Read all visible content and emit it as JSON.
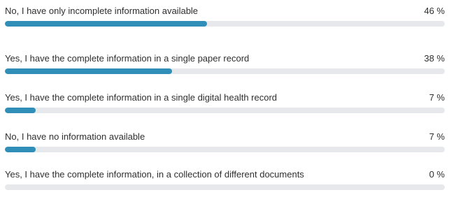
{
  "chart_data": {
    "type": "bar",
    "orientation": "horizontal",
    "categories": [
      "No, I have only incomplete information available",
      "Yes, I have the complete information in a single paper record",
      "Yes, I have the complete information in a single digital health record",
      "No, I have no information available",
      "Yes, I have the complete information, in a collection of different documents"
    ],
    "values": [
      46,
      38,
      7,
      7,
      0
    ],
    "value_labels": [
      "46 %",
      "38 %",
      "7 %",
      "7 %",
      "0 %"
    ],
    "xlim": [
      0,
      100
    ],
    "bar_color": "#2f8fb8",
    "track_color": "#e6e8eb"
  }
}
